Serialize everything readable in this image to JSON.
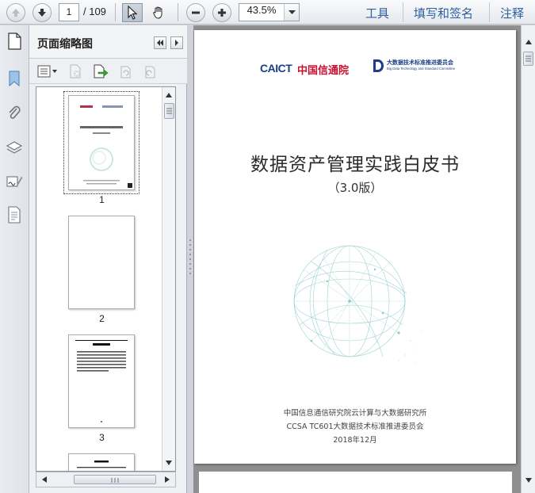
{
  "toolbar": {
    "current_page": "1",
    "total_pages": "/ 109",
    "zoom": "43.5%",
    "menu": [
      "工具",
      "填写和签名",
      "注释"
    ]
  },
  "panel": {
    "title": "页面缩略图",
    "thumbnails": [
      {
        "label": "1"
      },
      {
        "label": "2"
      },
      {
        "label": "3"
      }
    ]
  },
  "document": {
    "logo_caict_text": "CAICT",
    "logo_caict_cn": "中国信通院",
    "logo_bigdata_cn": "大数据技术标准推进委员会",
    "logo_bigdata_en": "Big Data Technology and Standard Committee",
    "title": "数据资产管理实践白皮书",
    "version": "（3.0版）",
    "org_line1": "中国信息通信研究院云计算与大数据研究所",
    "org_line2": "CCSA TC601大数据技术标准推进委员会",
    "date": "2018年12月"
  },
  "colors": {
    "accent_link": "#2c5fa3",
    "caict_red": "#c8102e",
    "caict_blue": "#1b3f8b",
    "globe_teal": "#7fc4c2"
  }
}
